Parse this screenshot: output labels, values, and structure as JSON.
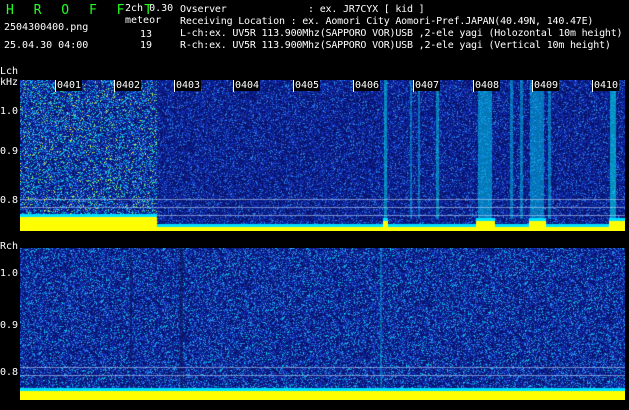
{
  "header": {
    "brand": "H R O F F T",
    "filename": "2504300400.png",
    "datetime": "25.04.30 04:00",
    "mode": "2ch 0.30",
    "meteor_label": "meteor",
    "meteor_l": "13",
    "meteor_r": "19"
  },
  "info": {
    "observer": "Ovserver              : ex. JR7CYX [ kid ]",
    "location": "Receiving Location : ex. Aomori City Aomori-Pref.JAPAN(40.49N, 140.47E)",
    "lch": "L-ch:ex. UV5R 113.900Mhz(SAPPORO VOR)USB ,2-ele yagi (Holozontal 10m height)",
    "rch": "R-ch:ex. UV5R 113.900Mhz(SAPPORO VOR)USB ,2-ele yagi (Vertical 10m height)"
  },
  "axes": {
    "lch_label": "Lch",
    "khz_label": "kHz",
    "rch_label": "Rch",
    "lch_ticks": [
      "1.0",
      "0.9",
      "0.8"
    ],
    "rch_ticks": [
      "1.0",
      "0.9",
      "0.8"
    ],
    "hours": [
      "0401",
      "0402",
      "0403",
      "0404",
      "0405",
      "0406",
      "0407",
      "0408",
      "0409",
      "0410"
    ]
  },
  "colors": {
    "background": "#000000",
    "brand": "#22ff22",
    "baseline": "#ffff00",
    "cyan": "#00e0ff",
    "deep": "#0a1a7a"
  }
}
